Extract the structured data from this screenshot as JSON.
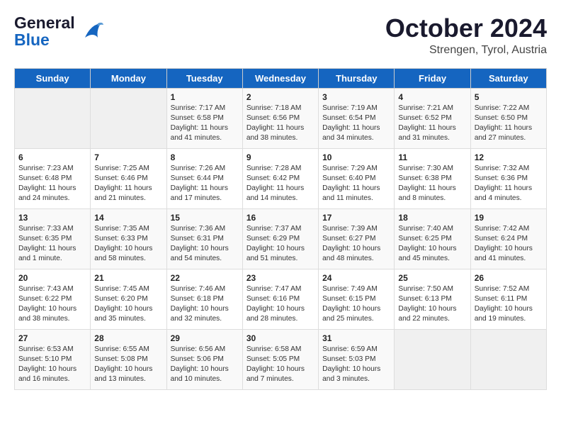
{
  "header": {
    "logo_line1": "General",
    "logo_line2": "Blue",
    "month": "October 2024",
    "location": "Strengen, Tyrol, Austria"
  },
  "days_of_week": [
    "Sunday",
    "Monday",
    "Tuesday",
    "Wednesday",
    "Thursday",
    "Friday",
    "Saturday"
  ],
  "weeks": [
    [
      {
        "day": "",
        "content": ""
      },
      {
        "day": "",
        "content": ""
      },
      {
        "day": "1",
        "content": "Sunrise: 7:17 AM\nSunset: 6:58 PM\nDaylight: 11 hours and 41 minutes."
      },
      {
        "day": "2",
        "content": "Sunrise: 7:18 AM\nSunset: 6:56 PM\nDaylight: 11 hours and 38 minutes."
      },
      {
        "day": "3",
        "content": "Sunrise: 7:19 AM\nSunset: 6:54 PM\nDaylight: 11 hours and 34 minutes."
      },
      {
        "day": "4",
        "content": "Sunrise: 7:21 AM\nSunset: 6:52 PM\nDaylight: 11 hours and 31 minutes."
      },
      {
        "day": "5",
        "content": "Sunrise: 7:22 AM\nSunset: 6:50 PM\nDaylight: 11 hours and 27 minutes."
      }
    ],
    [
      {
        "day": "6",
        "content": "Sunrise: 7:23 AM\nSunset: 6:48 PM\nDaylight: 11 hours and 24 minutes."
      },
      {
        "day": "7",
        "content": "Sunrise: 7:25 AM\nSunset: 6:46 PM\nDaylight: 11 hours and 21 minutes."
      },
      {
        "day": "8",
        "content": "Sunrise: 7:26 AM\nSunset: 6:44 PM\nDaylight: 11 hours and 17 minutes."
      },
      {
        "day": "9",
        "content": "Sunrise: 7:28 AM\nSunset: 6:42 PM\nDaylight: 11 hours and 14 minutes."
      },
      {
        "day": "10",
        "content": "Sunrise: 7:29 AM\nSunset: 6:40 PM\nDaylight: 11 hours and 11 minutes."
      },
      {
        "day": "11",
        "content": "Sunrise: 7:30 AM\nSunset: 6:38 PM\nDaylight: 11 hours and 8 minutes."
      },
      {
        "day": "12",
        "content": "Sunrise: 7:32 AM\nSunset: 6:36 PM\nDaylight: 11 hours and 4 minutes."
      }
    ],
    [
      {
        "day": "13",
        "content": "Sunrise: 7:33 AM\nSunset: 6:35 PM\nDaylight: 11 hours and 1 minute."
      },
      {
        "day": "14",
        "content": "Sunrise: 7:35 AM\nSunset: 6:33 PM\nDaylight: 10 hours and 58 minutes."
      },
      {
        "day": "15",
        "content": "Sunrise: 7:36 AM\nSunset: 6:31 PM\nDaylight: 10 hours and 54 minutes."
      },
      {
        "day": "16",
        "content": "Sunrise: 7:37 AM\nSunset: 6:29 PM\nDaylight: 10 hours and 51 minutes."
      },
      {
        "day": "17",
        "content": "Sunrise: 7:39 AM\nSunset: 6:27 PM\nDaylight: 10 hours and 48 minutes."
      },
      {
        "day": "18",
        "content": "Sunrise: 7:40 AM\nSunset: 6:25 PM\nDaylight: 10 hours and 45 minutes."
      },
      {
        "day": "19",
        "content": "Sunrise: 7:42 AM\nSunset: 6:24 PM\nDaylight: 10 hours and 41 minutes."
      }
    ],
    [
      {
        "day": "20",
        "content": "Sunrise: 7:43 AM\nSunset: 6:22 PM\nDaylight: 10 hours and 38 minutes."
      },
      {
        "day": "21",
        "content": "Sunrise: 7:45 AM\nSunset: 6:20 PM\nDaylight: 10 hours and 35 minutes."
      },
      {
        "day": "22",
        "content": "Sunrise: 7:46 AM\nSunset: 6:18 PM\nDaylight: 10 hours and 32 minutes."
      },
      {
        "day": "23",
        "content": "Sunrise: 7:47 AM\nSunset: 6:16 PM\nDaylight: 10 hours and 28 minutes."
      },
      {
        "day": "24",
        "content": "Sunrise: 7:49 AM\nSunset: 6:15 PM\nDaylight: 10 hours and 25 minutes."
      },
      {
        "day": "25",
        "content": "Sunrise: 7:50 AM\nSunset: 6:13 PM\nDaylight: 10 hours and 22 minutes."
      },
      {
        "day": "26",
        "content": "Sunrise: 7:52 AM\nSunset: 6:11 PM\nDaylight: 10 hours and 19 minutes."
      }
    ],
    [
      {
        "day": "27",
        "content": "Sunrise: 6:53 AM\nSunset: 5:10 PM\nDaylight: 10 hours and 16 minutes."
      },
      {
        "day": "28",
        "content": "Sunrise: 6:55 AM\nSunset: 5:08 PM\nDaylight: 10 hours and 13 minutes."
      },
      {
        "day": "29",
        "content": "Sunrise: 6:56 AM\nSunset: 5:06 PM\nDaylight: 10 hours and 10 minutes."
      },
      {
        "day": "30",
        "content": "Sunrise: 6:58 AM\nSunset: 5:05 PM\nDaylight: 10 hours and 7 minutes."
      },
      {
        "day": "31",
        "content": "Sunrise: 6:59 AM\nSunset: 5:03 PM\nDaylight: 10 hours and 3 minutes."
      },
      {
        "day": "",
        "content": ""
      },
      {
        "day": "",
        "content": ""
      }
    ]
  ]
}
